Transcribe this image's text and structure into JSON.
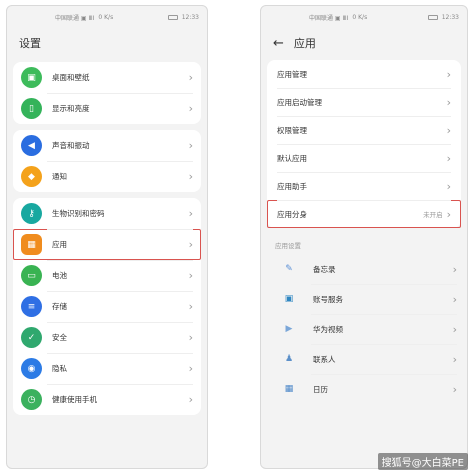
{
  "left": {
    "status": {
      "carrier": "中国联通 ▣ ⅢⅠ",
      "speed": "0 K/s",
      "time": "12:33"
    },
    "title": "设置",
    "groups": [
      [
        {
          "label": "桌面和壁纸",
          "color": "#3dbb5b",
          "icon": "image-icon",
          "glyph": "▣"
        },
        {
          "label": "显示和亮度",
          "color": "#34b35a",
          "icon": "display-icon",
          "glyph": "▯"
        }
      ],
      [
        {
          "label": "声音和振动",
          "color": "#2a6de0",
          "icon": "sound-icon",
          "glyph": "◀"
        },
        {
          "label": "通知",
          "color": "#f4a21b",
          "icon": "bell-icon",
          "glyph": "◆"
        }
      ],
      [
        {
          "label": "生物识别和密码",
          "color": "#18a8a0",
          "icon": "key-icon",
          "glyph": "⚷"
        },
        {
          "label": "应用",
          "color": "#f08c1e",
          "icon": "apps-icon",
          "glyph": "▦"
        },
        {
          "label": "电池",
          "color": "#39b352",
          "icon": "battery-icon",
          "glyph": "▭"
        },
        {
          "label": "存储",
          "color": "#2f6fe4",
          "icon": "storage-icon",
          "glyph": "≡"
        },
        {
          "label": "安全",
          "color": "#2fa86e",
          "icon": "shield-icon",
          "glyph": "✓"
        },
        {
          "label": "隐私",
          "color": "#2c7be5",
          "icon": "privacy-icon",
          "glyph": "◉"
        },
        {
          "label": "健康使用手机",
          "color": "#3bb15e",
          "icon": "health-icon",
          "glyph": "◷"
        }
      ]
    ]
  },
  "right": {
    "status": {
      "carrier": "中国联通 ▣ ⅢⅠ",
      "speed": "0 K/s",
      "time": "12:33"
    },
    "title": "应用",
    "menu": [
      {
        "label": "应用管理",
        "value": ""
      },
      {
        "label": "应用启动管理",
        "value": ""
      },
      {
        "label": "权限管理",
        "value": ""
      },
      {
        "label": "默认应用",
        "value": ""
      },
      {
        "label": "应用助手",
        "value": ""
      },
      {
        "label": "应用分身",
        "value": "未开启"
      }
    ],
    "section": "应用设置",
    "apps": [
      {
        "label": "备忘录",
        "icon": "memo-icon",
        "glyph": "✎",
        "color": "#5a8fd6"
      },
      {
        "label": "账号服务",
        "icon": "account-icon",
        "glyph": "▣",
        "color": "#2e86c1"
      },
      {
        "label": "华为视频",
        "icon": "video-icon",
        "glyph": "▶",
        "color": "#7aa6d8"
      },
      {
        "label": "联系人",
        "icon": "contacts-icon",
        "glyph": "♟",
        "color": "#5c90c9"
      },
      {
        "label": "日历",
        "icon": "calendar-icon",
        "glyph": "▦",
        "color": "#4a86c8"
      }
    ]
  },
  "watermark": "搜狐号@大白菜PE"
}
